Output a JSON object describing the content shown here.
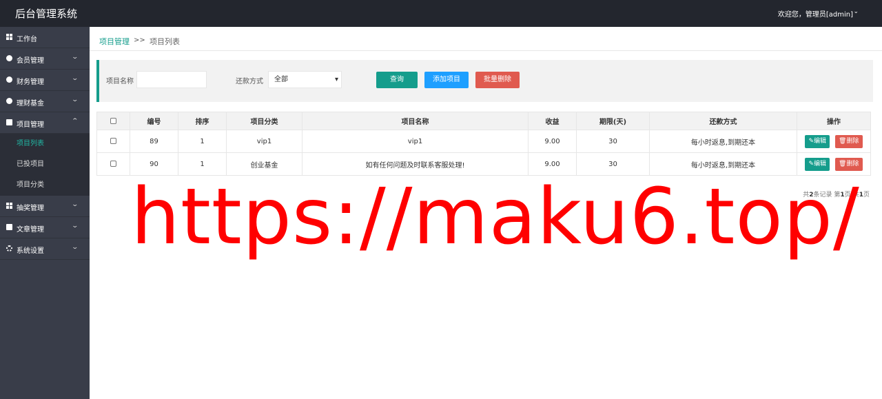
{
  "app": {
    "title": "后台管理系统",
    "user_greeting": "欢迎您，管理员[admin]"
  },
  "sidebar": {
    "items": [
      {
        "label": "工作台",
        "icon": "dashboard-icon"
      },
      {
        "label": "会员管理",
        "icon": "user-icon"
      },
      {
        "label": "财务管理",
        "icon": "finance-icon"
      },
      {
        "label": "理财基金",
        "icon": "fund-icon"
      },
      {
        "label": "项目管理",
        "icon": "project-icon"
      },
      {
        "label": "抽奖管理",
        "icon": "lottery-icon"
      },
      {
        "label": "文章管理",
        "icon": "article-icon"
      },
      {
        "label": "系统设置",
        "icon": "gear-icon"
      }
    ],
    "sub_items": [
      "项目列表",
      "已投项目",
      "项目分类"
    ]
  },
  "breadcrumb": {
    "parent": "项目管理",
    "separator": ">>",
    "current": "项目列表"
  },
  "filter": {
    "name_label": "项目名称",
    "name_value": "",
    "repay_label": "还款方式",
    "repay_value": "全部",
    "search_label": "查询",
    "add_label": "添加项目",
    "batch_delete_label": "批量删除"
  },
  "table": {
    "headers": [
      "编号",
      "排序",
      "项目分类",
      "项目名称",
      "收益",
      "期限(天)",
      "还款方式",
      "操作"
    ],
    "rows": [
      {
        "id": "89",
        "sort": "1",
        "category": "vip1",
        "name": "vip1",
        "yield": "9.00",
        "term": "30",
        "repay": "每小时返息,到期还本"
      },
      {
        "id": "90",
        "sort": "1",
        "category": "创业基金",
        "name": "如有任何问题及时联系客服处理!",
        "yield": "9.00",
        "term": "30",
        "repay": "每小时返息,到期还本"
      }
    ],
    "edit_label": "编辑",
    "delete_label": "删除"
  },
  "pager": {
    "prefix": "共",
    "total": "2",
    "mid": "条记录 第",
    "page": "1",
    "mid2": "页/共",
    "pages": "1",
    "suffix": "页"
  },
  "watermark": "https://maku6.top/",
  "colors": {
    "accent": "#159d8c",
    "blue": "#1e9fff",
    "danger": "#e05a4f",
    "topbar": "#23262e",
    "sidebar": "#393d49"
  }
}
